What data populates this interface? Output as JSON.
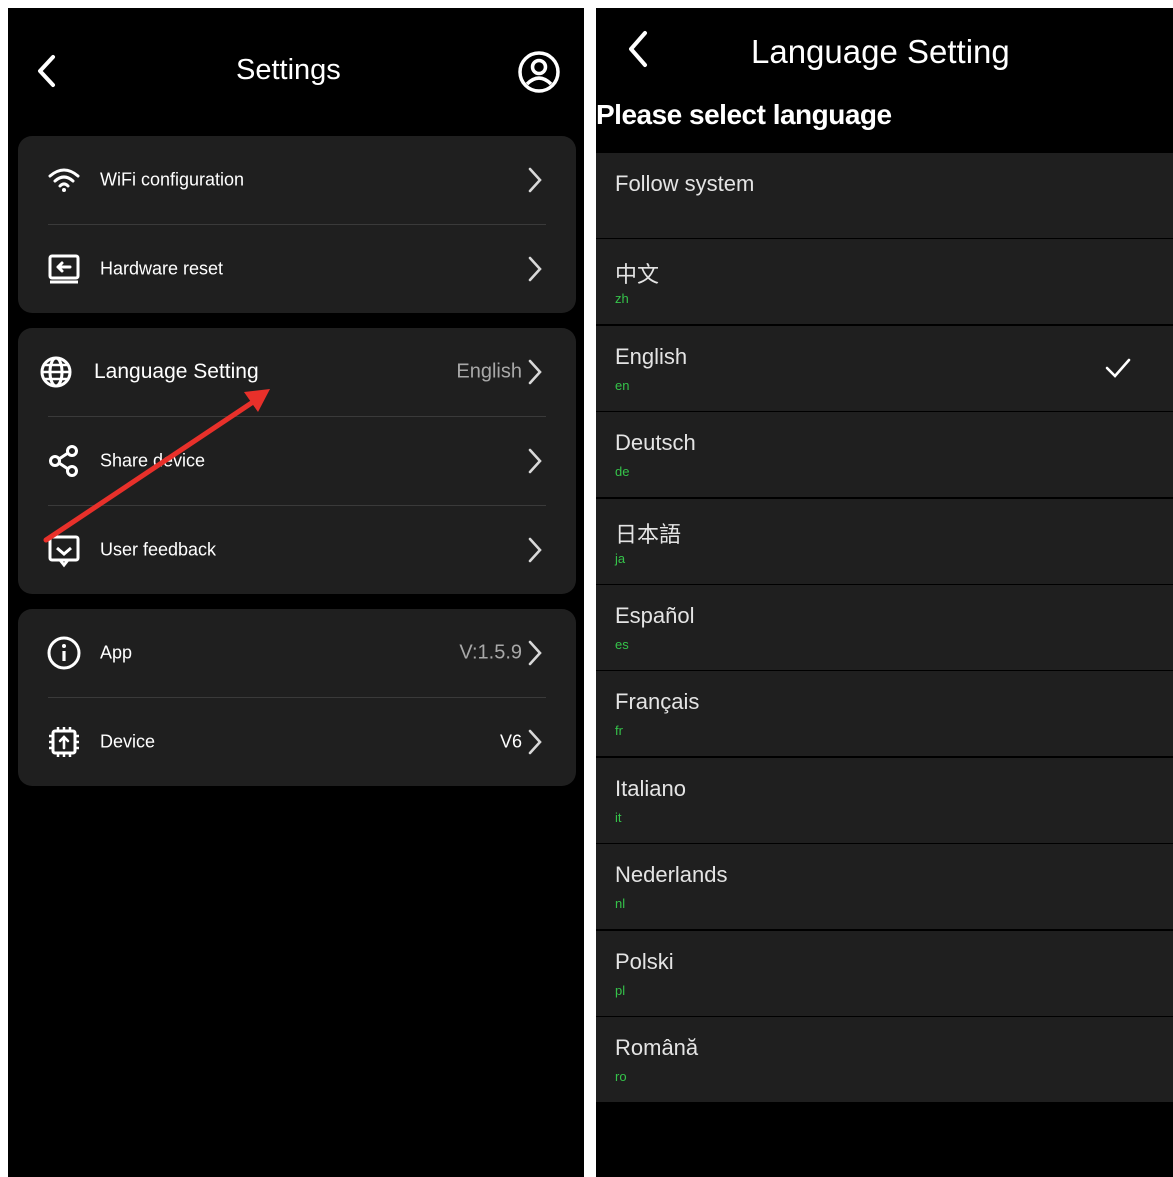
{
  "settings": {
    "title": "Settings",
    "groups": [
      {
        "rows": [
          {
            "label": "WiFi configuration",
            "value": ""
          },
          {
            "label": "Hardware reset",
            "value": ""
          }
        ]
      },
      {
        "rows": [
          {
            "label": "Language Setting",
            "value": "English"
          },
          {
            "label": "Share device",
            "value": ""
          },
          {
            "label": "User feedback",
            "value": ""
          }
        ]
      },
      {
        "rows": [
          {
            "label": "App",
            "value": "V:1.5.9"
          },
          {
            "label": "Device",
            "value": "V6"
          }
        ]
      }
    ],
    "icons": [
      "wifi-icon",
      "hardware-reset-icon",
      "globe-icon",
      "share-icon",
      "feedback-icon",
      "info-icon",
      "device-chip-icon"
    ]
  },
  "language": {
    "title": "Language Setting",
    "subtitle": "Please select language",
    "options": [
      {
        "name": "Follow system",
        "code": ""
      },
      {
        "name": "中文",
        "code": "zh"
      },
      {
        "name": "English",
        "code": "en",
        "selected": true
      },
      {
        "name": "Deutsch",
        "code": "de"
      },
      {
        "name": "日本語",
        "code": "ja"
      },
      {
        "name": "Español",
        "code": "es"
      },
      {
        "name": "Français",
        "code": "fr"
      },
      {
        "name": "Italiano",
        "code": "it"
      },
      {
        "name": "Nederlands",
        "code": "nl"
      },
      {
        "name": "Polski",
        "code": "pl"
      },
      {
        "name": "Română",
        "code": "ro"
      }
    ]
  },
  "colors": {
    "accent_code": "#35c34a",
    "annotation_arrow": "#e8302a",
    "panel_bg": "#000000",
    "row_bg": "#1f1f1f"
  }
}
